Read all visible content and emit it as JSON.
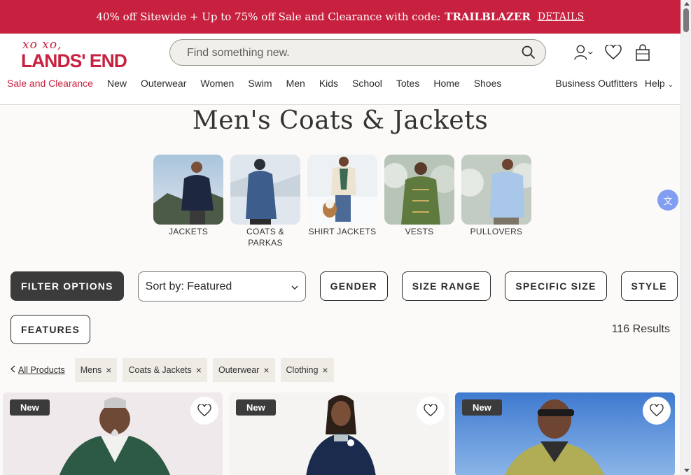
{
  "promo": {
    "text": "40% off Sitewide + Up to 75% off Sale and Clearance with code:",
    "code": "TRAILBLAZER",
    "details": "DETAILS"
  },
  "header": {
    "logo_tagline": "xo xo,",
    "logo_brand": "LANDS' END",
    "search_placeholder": "Find something new."
  },
  "nav": {
    "items": [
      "Sale and Clearance",
      "New",
      "Outerwear",
      "Women",
      "Swim",
      "Men",
      "Kids",
      "School",
      "Totes",
      "Home",
      "Shoes"
    ],
    "right": [
      "Business Outfitters",
      "Help"
    ]
  },
  "page_title": "Men's Coats & Jackets",
  "categories": [
    {
      "label": "JACKETS"
    },
    {
      "label": "COATS & PARKAS"
    },
    {
      "label": "SHIRT JACKETS"
    },
    {
      "label": "VESTS"
    },
    {
      "label": "PULLOVERS"
    }
  ],
  "filters": {
    "filter_options": "FILTER OPTIONS",
    "sort": "Sort by: Featured",
    "gender": "GENDER",
    "size_range": "SIZE RANGE",
    "specific_size": "SPECIFIC SIZE",
    "style": "STYLE",
    "features": "FEATURES",
    "results": "116 Results"
  },
  "breadcrumbs": {
    "back": "All Products",
    "chips": [
      "Mens",
      "Coats & Jackets",
      "Outerwear",
      "Clothing"
    ]
  },
  "products": [
    {
      "badge": "New"
    },
    {
      "badge": "New"
    },
    {
      "badge": "New"
    }
  ],
  "colors": {
    "brand_red": "#c8203f",
    "dark_button": "#3b3b3b"
  }
}
